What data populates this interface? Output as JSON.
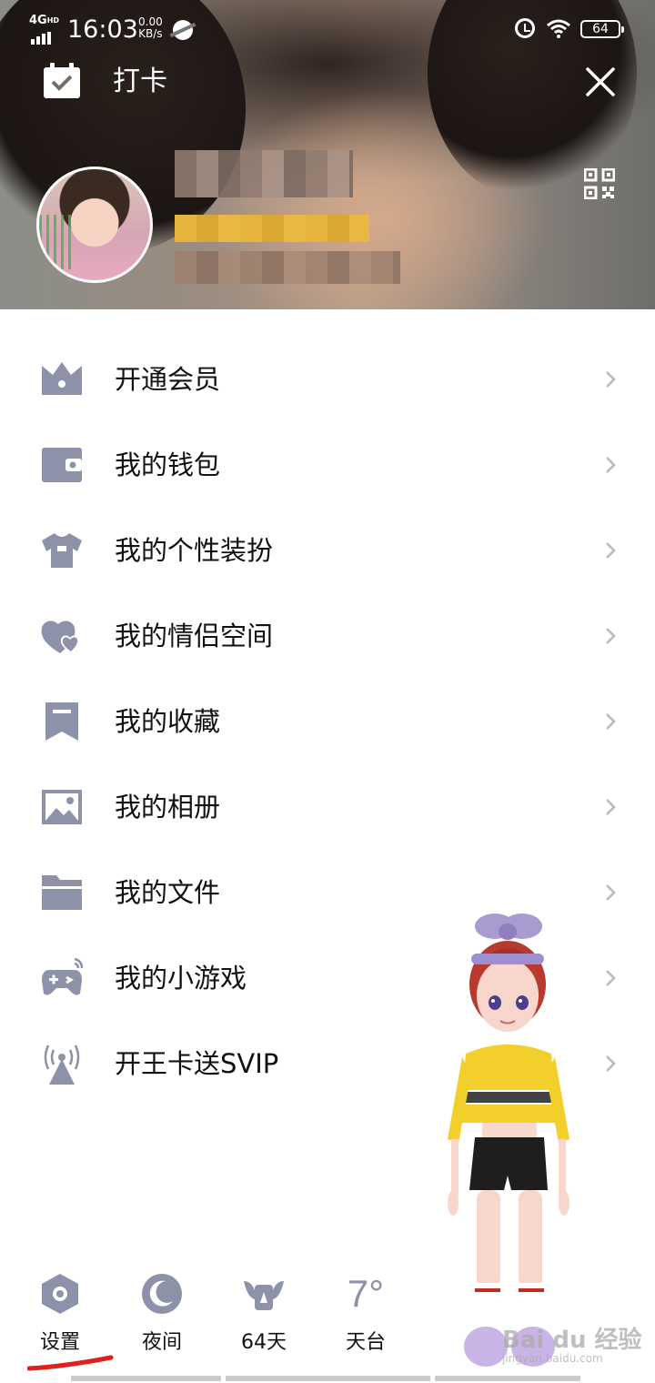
{
  "status_bar": {
    "network": "4G",
    "network_sup": "HD",
    "time": "16:03",
    "speed_value": "0.00",
    "speed_unit": "KB/s",
    "battery": "64"
  },
  "header": {
    "checkin_label": "打卡",
    "close_icon": "close-icon",
    "qr_icon": "qr-code-icon"
  },
  "menu": {
    "items": [
      {
        "label": "开通会员",
        "icon": "crown-icon"
      },
      {
        "label": "我的钱包",
        "icon": "wallet-icon"
      },
      {
        "label": "我的个性装扮",
        "icon": "tshirt-icon"
      },
      {
        "label": "我的情侣空间",
        "icon": "hearts-icon"
      },
      {
        "label": "我的收藏",
        "icon": "bookmark-icon"
      },
      {
        "label": "我的相册",
        "icon": "photo-icon"
      },
      {
        "label": "我的文件",
        "icon": "folder-icon"
      },
      {
        "label": "我的小游戏",
        "icon": "gamepad-icon"
      },
      {
        "label": "开王卡送SVIP",
        "icon": "signal-tower-icon"
      }
    ]
  },
  "bottom_bar": {
    "settings_label": "设置",
    "night_label": "夜间",
    "days_label": "64天",
    "weather_temp": "7°",
    "weather_label": "天台"
  },
  "watermark": {
    "text": "Bai du 经验",
    "url_text": "jingyan.baidu.com"
  },
  "colors": {
    "icon_gray": "#8e92a8",
    "text": "#111111",
    "annotation_red": "#e0201c"
  }
}
